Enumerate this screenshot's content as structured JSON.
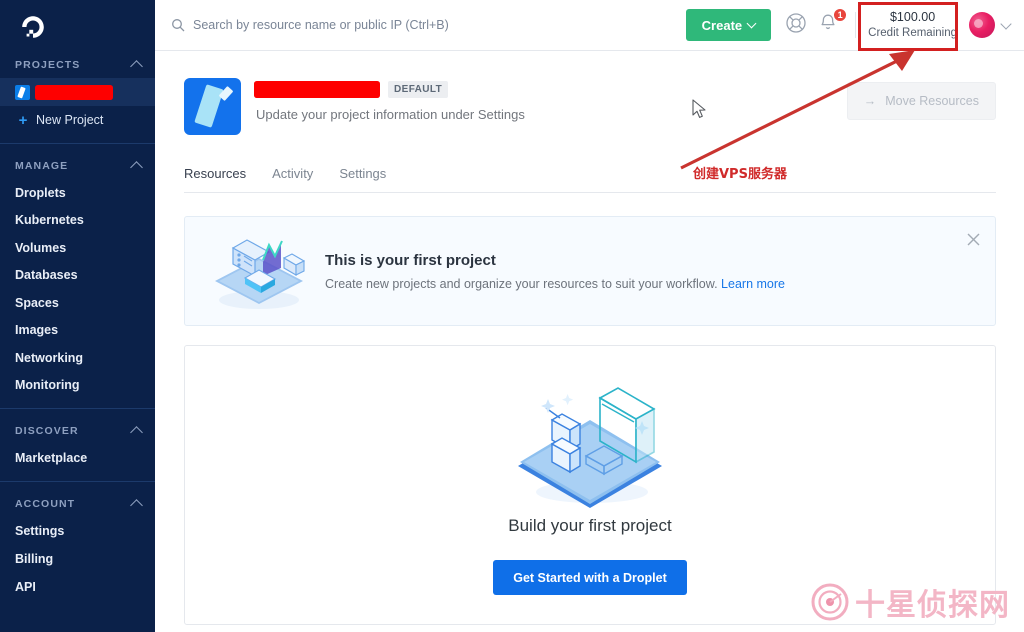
{
  "sidebar": {
    "logo_name": "digitalocean-logo",
    "projects": {
      "header": "PROJECTS",
      "active_project_redacted": "",
      "new_project_label": "New Project"
    },
    "manage": {
      "header": "MANAGE",
      "items": [
        {
          "label": "Droplets"
        },
        {
          "label": "Kubernetes"
        },
        {
          "label": "Volumes"
        },
        {
          "label": "Databases"
        },
        {
          "label": "Spaces"
        },
        {
          "label": "Images"
        },
        {
          "label": "Networking"
        },
        {
          "label": "Monitoring"
        }
      ]
    },
    "discover": {
      "header": "DISCOVER",
      "items": [
        {
          "label": "Marketplace"
        }
      ]
    },
    "account": {
      "header": "ACCOUNT",
      "items": [
        {
          "label": "Settings"
        },
        {
          "label": "Billing"
        },
        {
          "label": "API"
        }
      ]
    }
  },
  "header": {
    "search_placeholder": "Search by resource name or public IP (Ctrl+B)",
    "search_value": "",
    "create_label": "Create",
    "help_icon": "lifebuoy-icon",
    "bell_icon": "bell-icon",
    "bell_badge_count": "1",
    "credit_amount": "$100.00",
    "credit_label": "Credit Remaining",
    "avatar_name": "user-avatar"
  },
  "project": {
    "name_redacted": "",
    "badge": "DEFAULT",
    "subtitle": "Update your project information under Settings",
    "move_resources_label": "Move Resources",
    "tabs": [
      {
        "label": "Resources",
        "active": true
      },
      {
        "label": "Activity",
        "active": false
      },
      {
        "label": "Settings",
        "active": false
      }
    ]
  },
  "banner": {
    "title": "This is your first project",
    "description": "Create new projects and organize your resources to suit your workflow.",
    "link_label": "Learn more",
    "close_icon": "close-icon"
  },
  "empty_state": {
    "title": "Build your first project",
    "cta_label": "Get Started with a Droplet"
  },
  "annotations": {
    "callout_text": "创建VPS服务器",
    "highlight_color": "#d32020",
    "arrow_color": "#c9342f"
  },
  "watermark": {
    "text": "十星侦探网",
    "color": "#f3b6c6"
  },
  "colors": {
    "sidebar_bg": "#0b2149",
    "create_green": "#2fb87a",
    "droplet_blue": "#0f6fe8",
    "badge_red": "#e8453c"
  }
}
